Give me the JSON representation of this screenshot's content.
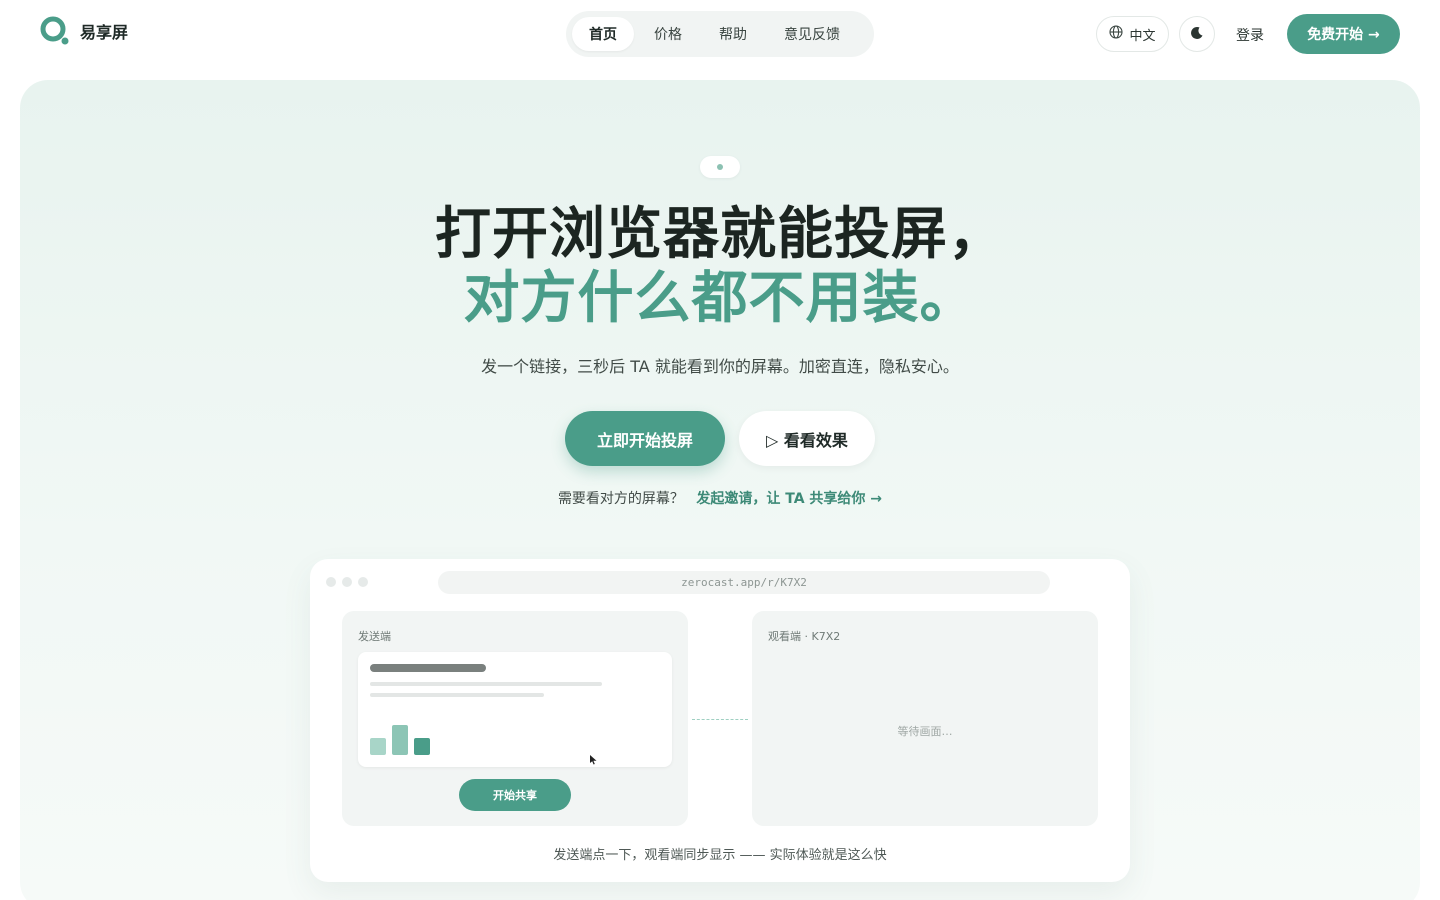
{
  "brand": {
    "name": "易享屏",
    "logo_icon": "q-ring-logo-icon",
    "accent": "#4a9d89"
  },
  "nav": {
    "items": [
      {
        "label": "首页",
        "active": true
      },
      {
        "label": "价格",
        "active": false
      },
      {
        "label": "帮助",
        "active": false
      },
      {
        "label": "意见反馈",
        "active": false
      }
    ]
  },
  "header": {
    "language_label": "中文",
    "language_icon": "globe-icon",
    "theme_icon": "moon-icon",
    "login_label": "登录",
    "cta_label": "免费开始 →"
  },
  "hero": {
    "title_line1": "打开浏览器就能投屏，",
    "title_line2": "对方什么都不用装。",
    "subtitle": "发一个链接，三秒后 TA 就能看到你的屏幕。加密直连，隐私安心。",
    "primary_button": "立即开始投屏",
    "secondary_button": "▷ 看看效果",
    "invite_text": "需要看对方的屏幕？",
    "invite_link": "发起邀请，让 TA 共享给你 →"
  },
  "demo": {
    "url": "zerocast.app/r/K7X2",
    "sender_label": "发送端",
    "viewer_label": "观看端 · K7X2",
    "share_button": "开始共享",
    "waiting_text": "等待画面…",
    "caption": "发送端点一下，观看端同步显示 —— 实际体验就是这么快",
    "mini_chart_values": [
      0.55,
      1.0,
      0.55
    ]
  }
}
